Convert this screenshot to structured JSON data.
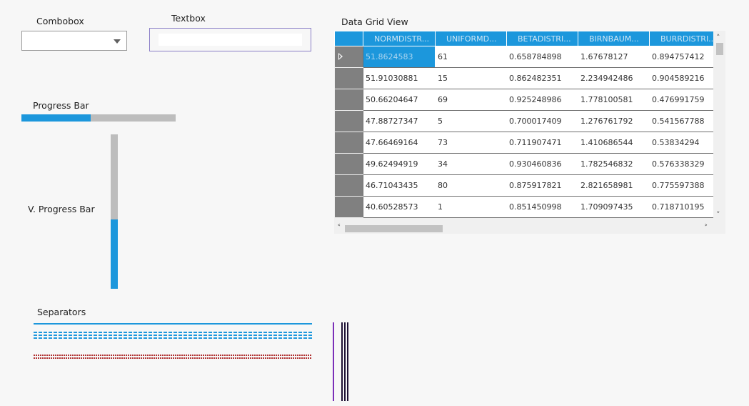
{
  "combobox": {
    "label": "Combobox",
    "value": ""
  },
  "textbox": {
    "label": "Textbox",
    "value": ""
  },
  "progress_bar": {
    "label": "Progress Bar",
    "percent": 45
  },
  "v_progress_bar": {
    "label": "V. Progress Bar",
    "percent": 45
  },
  "data_grid": {
    "label": "Data Grid View",
    "columns": [
      "NORMDISTR...",
      "UNIFORMD...",
      "BETADISTRI...",
      "BIRNBAUM...",
      "BURRDISTRI..."
    ],
    "rows": [
      [
        "51.8624583",
        "61",
        "0.658784898",
        "1.67678127",
        "0.894757412"
      ],
      [
        "51.91030881",
        "15",
        "0.862482351",
        "2.234942486",
        "0.904589216"
      ],
      [
        "50.66204647",
        "69",
        "0.925248986",
        "1.778100581",
        "0.476991759"
      ],
      [
        "47.88727347",
        "5",
        "0.700017409",
        "1.276761792",
        "0.541567788"
      ],
      [
        "47.66469164",
        "73",
        "0.711907471",
        "1.410686544",
        "0.53834294"
      ],
      [
        "49.62494919",
        "34",
        "0.930460836",
        "1.782546832",
        "0.576338329"
      ],
      [
        "46.71043435",
        "80",
        "0.875917821",
        "2.821658981",
        "0.775597388"
      ],
      [
        "40.60528573",
        "1",
        "0.851450998",
        "1.709097435",
        "0.718710195"
      ]
    ]
  },
  "separators": {
    "label": "Separators"
  },
  "colors": {
    "accent": "#1c97dc",
    "separator_dotted": "#b03030",
    "vsep_purple": "#7b2fb8",
    "vsep_dark": "#1e1034",
    "textbox_border": "#8b7fc7"
  }
}
